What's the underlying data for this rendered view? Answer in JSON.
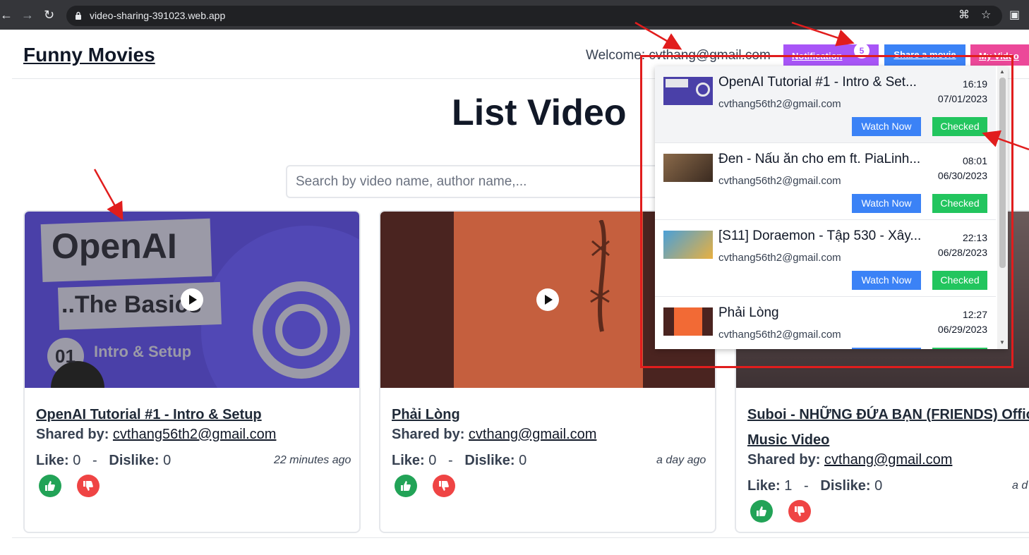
{
  "browser": {
    "url": "video-sharing-391023.web.app"
  },
  "header": {
    "brand": "Funny Movies",
    "welcome": "Welcome: cvthang@gmail.com",
    "notification_label": "Notification",
    "notification_count": "5",
    "share_label": "Share a movie",
    "myvideo_label": "My Video"
  },
  "main": {
    "title": "List Video",
    "search_placeholder": "Search by video name, author name,..."
  },
  "labels": {
    "shared_by": "Shared by:",
    "like": "Like:",
    "dislike": "Dislike:",
    "sep": "-"
  },
  "videos": [
    {
      "title": "OpenAI Tutorial #1 - Intro & Setup",
      "author": "cvthang56th2@gmail.com",
      "likes": "0",
      "dislikes": "0",
      "ago": "22 minutes ago",
      "thumb_text_1": "OpenAI",
      "thumb_text_2": "..The Basics",
      "thumb_text_3": "01",
      "thumb_text_4": "Intro & Setup"
    },
    {
      "title": "Phải Lòng",
      "author": "cvthang@gmail.com",
      "likes": "0",
      "dislikes": "0",
      "ago": "a day ago"
    },
    {
      "title": "Suboi - NHỮNG ĐỨA BẠN (FRIENDS) Offic",
      "title_line2": "Music Video",
      "author": "cvthang@gmail.com",
      "likes": "1",
      "dislikes": "0",
      "ago": "a d"
    }
  ],
  "notifications": {
    "watch_label": "Watch Now",
    "checked_label": "Checked",
    "items": [
      {
        "title": "OpenAI Tutorial #1 - Intro & Set...",
        "author": "cvthang56th2@gmail.com",
        "time": "16:19",
        "date": "07/01/2023"
      },
      {
        "title": "Đen - Nấu ăn cho em ft. PiaLinh...",
        "author": "cvthang56th2@gmail.com",
        "time": "08:01",
        "date": "06/30/2023"
      },
      {
        "title": "[S11] Doraemon - Tập 530 - Xây...",
        "author": "cvthang56th2@gmail.com",
        "time": "22:13",
        "date": "06/28/2023"
      },
      {
        "title": "Phải Lòng",
        "author": "cvthang56th2@gmail.com",
        "time": "12:27",
        "date": "06/29/2023"
      }
    ]
  },
  "colors": {
    "notification": "#a855f7",
    "share": "#3b82f6",
    "myvideo": "#ec4899",
    "checked": "#22c55e",
    "annotation": "#e11d1d"
  }
}
